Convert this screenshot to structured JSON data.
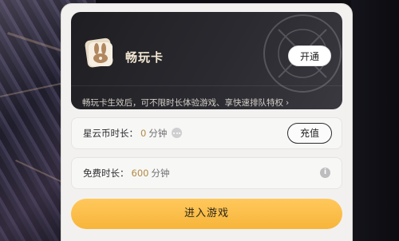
{
  "card": {
    "title": "畅玩卡",
    "open_button": "开通",
    "description": "畅玩卡生效后，可不限时长体验游戏、享快速排队特权",
    "chevron": "›"
  },
  "nebula_coin": {
    "label": "星云币时长：",
    "value": "0",
    "unit": "分钟",
    "recharge_button": "充值"
  },
  "free_time": {
    "label": "免费时长：",
    "value": "600",
    "unit": "分钟",
    "info_glyph": "i"
  },
  "enter_button": "进入游戏",
  "colors": {
    "accent_gold": "#b28a42",
    "enter_button_bg": "#f7b53a",
    "card_bg": "#1e1e22"
  },
  "icons": {
    "card": "rabbit-ticket-icon",
    "more": "dots-icon",
    "info": "info-icon",
    "chevron": "chevron-right-icon"
  }
}
